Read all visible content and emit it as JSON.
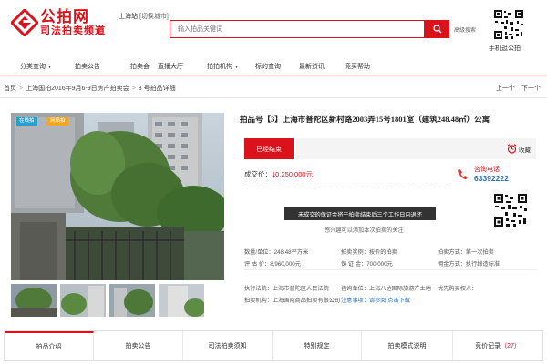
{
  "header": {
    "logo_title": "公拍网",
    "logo_sub": "司法拍卖频道",
    "city": "上海站",
    "city_switch": "[切换城市]",
    "search_placeholder": "输入拍品关键词",
    "advanced_search": "高级搜索",
    "qr_label": "手机逛公拍"
  },
  "nav": {
    "items": [
      {
        "label": "分类查询",
        "has_caret": true
      },
      {
        "label": "拍卖公告",
        "has_caret": false
      },
      {
        "label": "拍卖会",
        "has_caret": false
      },
      {
        "label": "直播大厅",
        "has_caret": false
      },
      {
        "label": "拍拍机构",
        "has_caret": true
      },
      {
        "label": "标的查询",
        "has_caret": false
      },
      {
        "label": "最新资讯",
        "has_caret": false
      },
      {
        "label": "竞买帮助",
        "has_caret": false
      }
    ]
  },
  "breadcrumb": {
    "items": [
      "首页",
      "上海国拍2016年9月6-9日房产拍卖会",
      "3 号拍品详细"
    ],
    "sep": ">",
    "prev": "上一个",
    "next": "下一个"
  },
  "photo": {
    "badges": [
      {
        "label": "在线拍",
        "color": "#27a2cf"
      },
      {
        "label": "网络拍",
        "color": "#f5a623"
      }
    ]
  },
  "lot": {
    "title": "拍品号【3】上海市普陀区新村路2003弄15号1801室（建筑248.48㎡）公寓",
    "status": "已经结束",
    "favorite": "收藏",
    "price_label": "成交价：",
    "price": "10,250,000元",
    "phone_label": "咨询电话",
    "phone": "63392222",
    "notice": "未成交的保证金将于拍卖结束后三个工作日内退还",
    "watch": "感兴趣可以添加本次拍卖的关注"
  },
  "details": {
    "rows": [
      [
        "数量/单位：248.48平方米",
        "拍卖实例：按价的拍卖",
        "拍卖方式：第一次拍卖"
      ],
      [
        "评 估 价：8,960,000元",
        "保 证 金：700,000元",
        "佣金方式：执行缔造标准"
      ],
      [
        "执行法院：上海市普陀区人民法院",
        "咨询单位：上海八达国际旅游产土地一",
        "优先购买权人："
      ],
      [
        "拍卖机构：上海国际商品拍卖有限公司",
        "注意事项：请参阅 点击下载",
        ""
      ]
    ]
  },
  "tabs": {
    "items": [
      "拍品介绍",
      "拍卖公告",
      "司法拍卖须知",
      "特别规定",
      "拍卖模式说明",
      "竞价记录"
    ],
    "bid_count": "（27）"
  },
  "colors": {
    "brand": "#d9121b",
    "link": "#2a6fb7"
  }
}
